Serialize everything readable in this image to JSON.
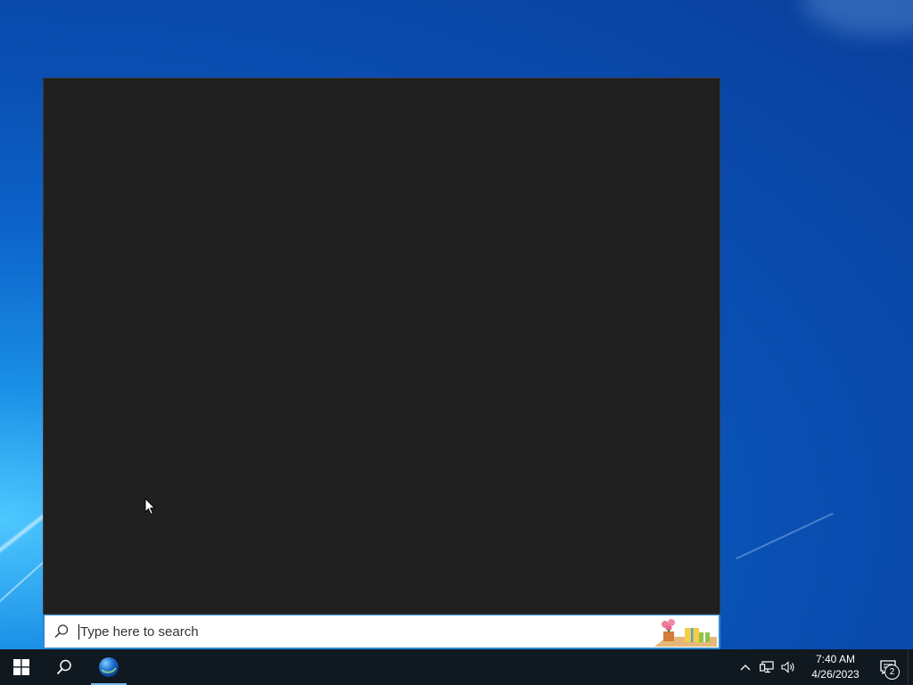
{
  "search": {
    "placeholder": "Type here to search"
  },
  "taskbar": {
    "start_icon": "windows-logo-icon",
    "search_icon": "search-icon",
    "pinned_app_icon": "edge-browser-icon"
  },
  "tray": {
    "time": "7:40 AM",
    "date": "4/26/2023",
    "notification_count": "2",
    "icons": [
      "chevron-up-icon",
      "network-icon",
      "volume-icon",
      "notification-icon"
    ]
  },
  "colors": {
    "panel_bg": "#202020",
    "taskbar_bg": "#101820",
    "accent": "#2b8bd6"
  }
}
